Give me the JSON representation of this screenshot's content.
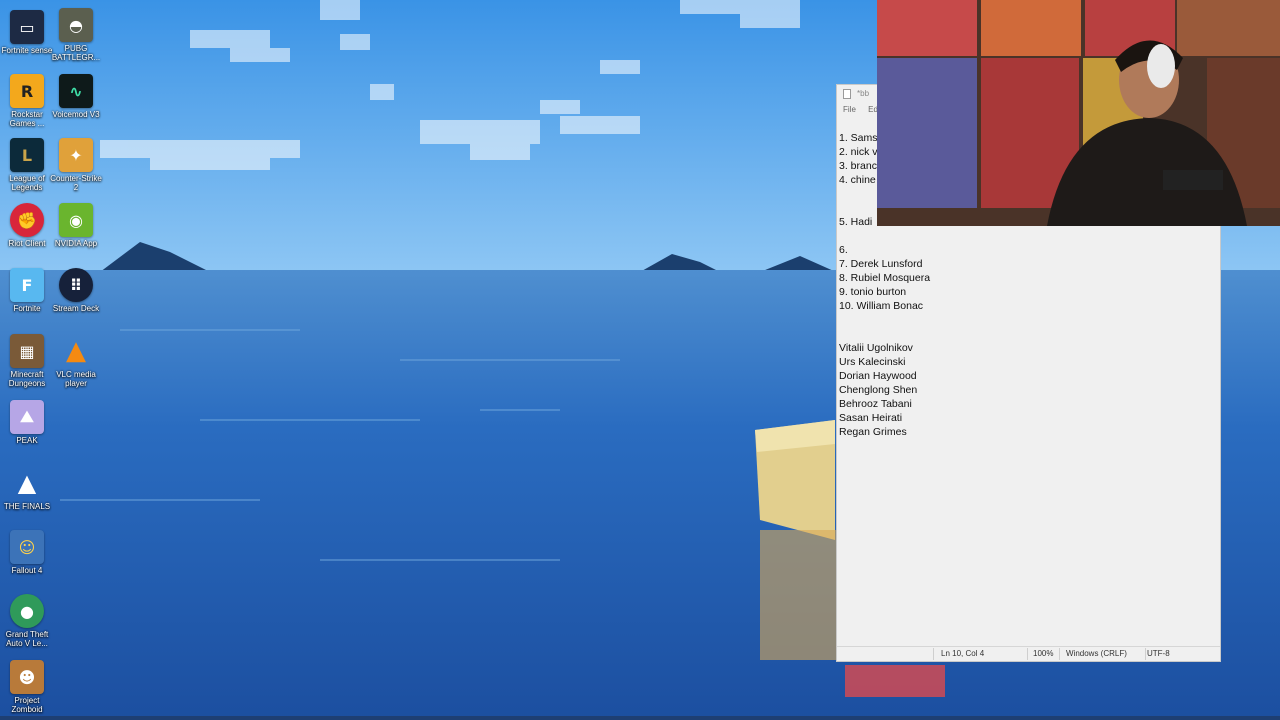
{
  "desktop": {
    "icons": [
      {
        "label": "Fortnite sense",
        "icon": "monitor-icon"
      },
      {
        "label": "PUBG BATTLEGR...",
        "icon": "helmet-icon"
      },
      {
        "label": "Rockstar Games ...",
        "icon": "rockstar-icon"
      },
      {
        "label": "Voicemod V3",
        "icon": "voicemod-icon"
      },
      {
        "label": "League of Legends",
        "icon": "league-icon"
      },
      {
        "label": "Counter-Strike 2",
        "icon": "counter-strike-icon"
      },
      {
        "label": "Riot Client",
        "icon": "riot-icon"
      },
      {
        "label": "NVIDIA App",
        "icon": "nvidia-icon"
      },
      {
        "label": "Fortnite",
        "icon": "fortnite-icon"
      },
      {
        "label": "Stream Deck",
        "icon": "stream-deck-icon"
      },
      {
        "label": "Minecraft Dungeons",
        "icon": "minecraft-icon"
      },
      {
        "label": "VLC media player",
        "icon": "vlc-icon"
      },
      {
        "label": "PEAK",
        "icon": "peak-icon"
      },
      {
        "label": "THE FINALS",
        "icon": "finals-icon"
      },
      {
        "label": "Fallout 4",
        "icon": "fallout-icon"
      },
      {
        "label": "Grand Theft Auto V Le...",
        "icon": "gta-icon"
      },
      {
        "label": "Project Zomboid",
        "icon": "zomboid-icon"
      }
    ]
  },
  "notepad": {
    "title": "*bb",
    "menu": [
      "File",
      "Edit"
    ],
    "lines": [
      "1. Sams",
      "2. nick v",
      "3. branc",
      "4. chine",
      "",
      "",
      "5. Hadi",
      "",
      "6.",
      "7. Derek Lunsford",
      "8. Rubiel Mosquera",
      "9. tonio burton",
      "10. William Bonac",
      "",
      "",
      "Vitalii Ugolnikov",
      "Urs Kalecinski",
      "Dorian Haywood",
      "Chenglong Shen",
      "Behrooz Tabani",
      "Sasan Heirati",
      "Regan Grimes"
    ],
    "status": {
      "position": "Ln 10, Col 4",
      "zoom": "100%",
      "line_ending": "Windows (CRLF)",
      "encoding": "UTF-8"
    }
  },
  "colors": {
    "sky": "#4a9fe8",
    "sea": "#1f5fb0",
    "notepad_bg": "#f0f0f0"
  }
}
